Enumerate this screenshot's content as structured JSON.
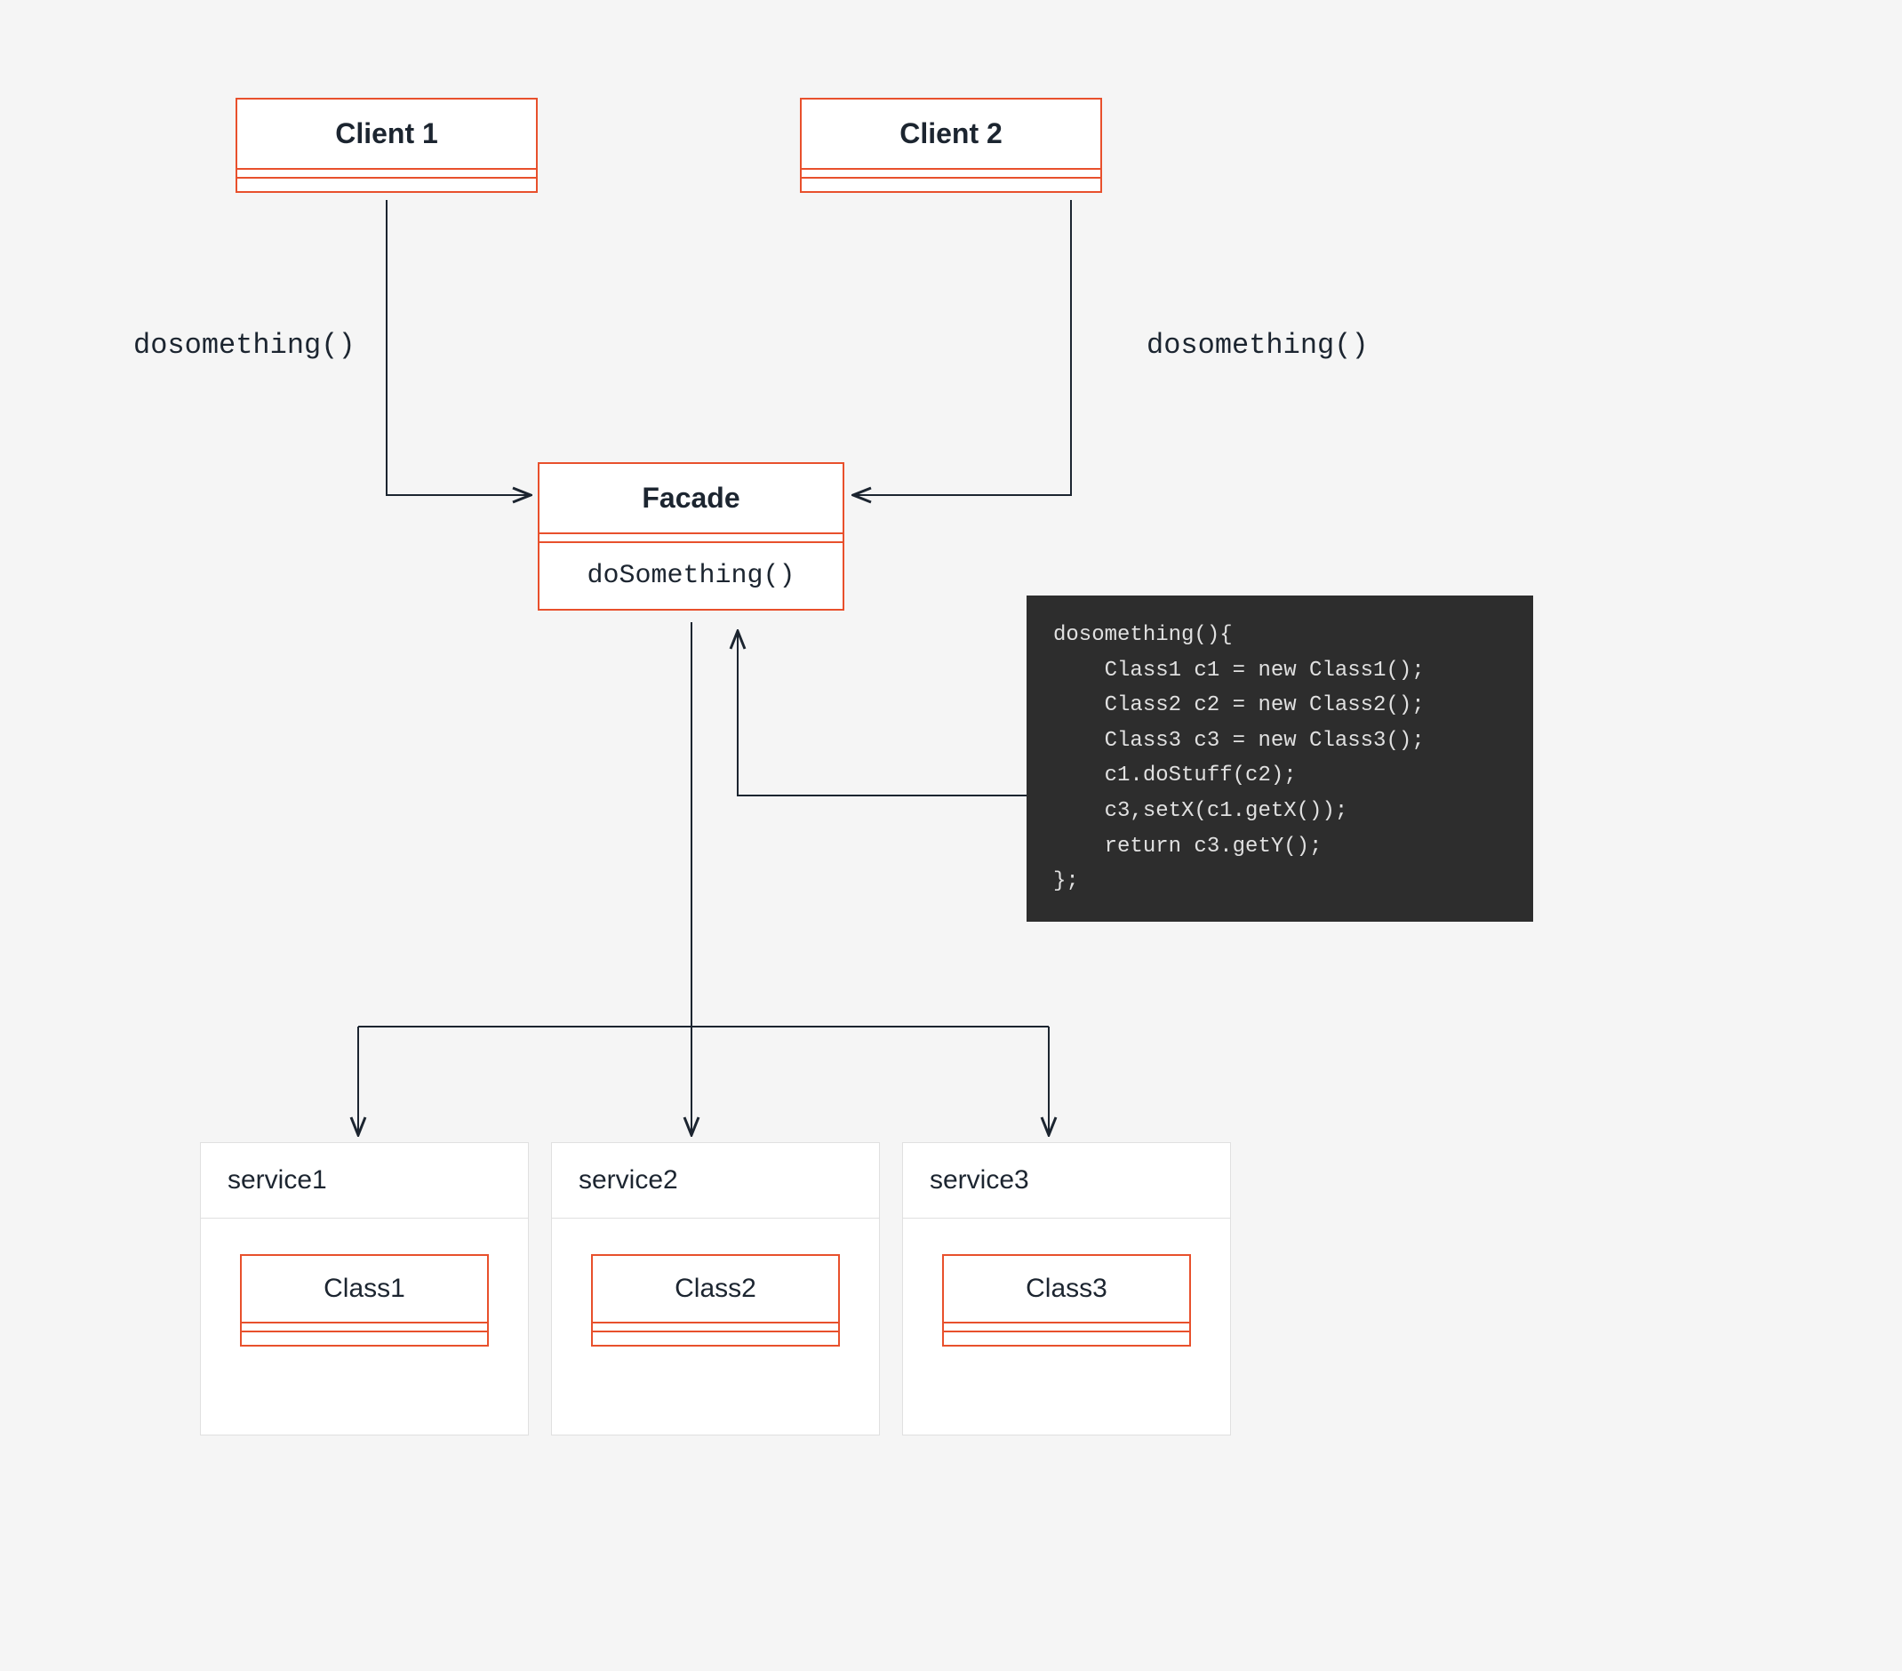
{
  "clients": [
    {
      "label": "Client 1"
    },
    {
      "label": "Client 2"
    }
  ],
  "call_labels": [
    "dosomething()",
    "dosomething()"
  ],
  "facade": {
    "title": "Facade",
    "method": "doSomething()"
  },
  "code_snippet": "dosomething(){\n    Class1 c1 = new Class1();\n    Class2 c2 = new Class2();\n    Class3 c3 = new Class3();\n    c1.doStuff(c2);\n    c3,setX(c1.getX());\n    return c3.getY();\n};",
  "services": [
    {
      "name": "service1",
      "class_name": "Class1"
    },
    {
      "name": "service2",
      "class_name": "Class2"
    },
    {
      "name": "service3",
      "class_name": "Class3"
    }
  ]
}
